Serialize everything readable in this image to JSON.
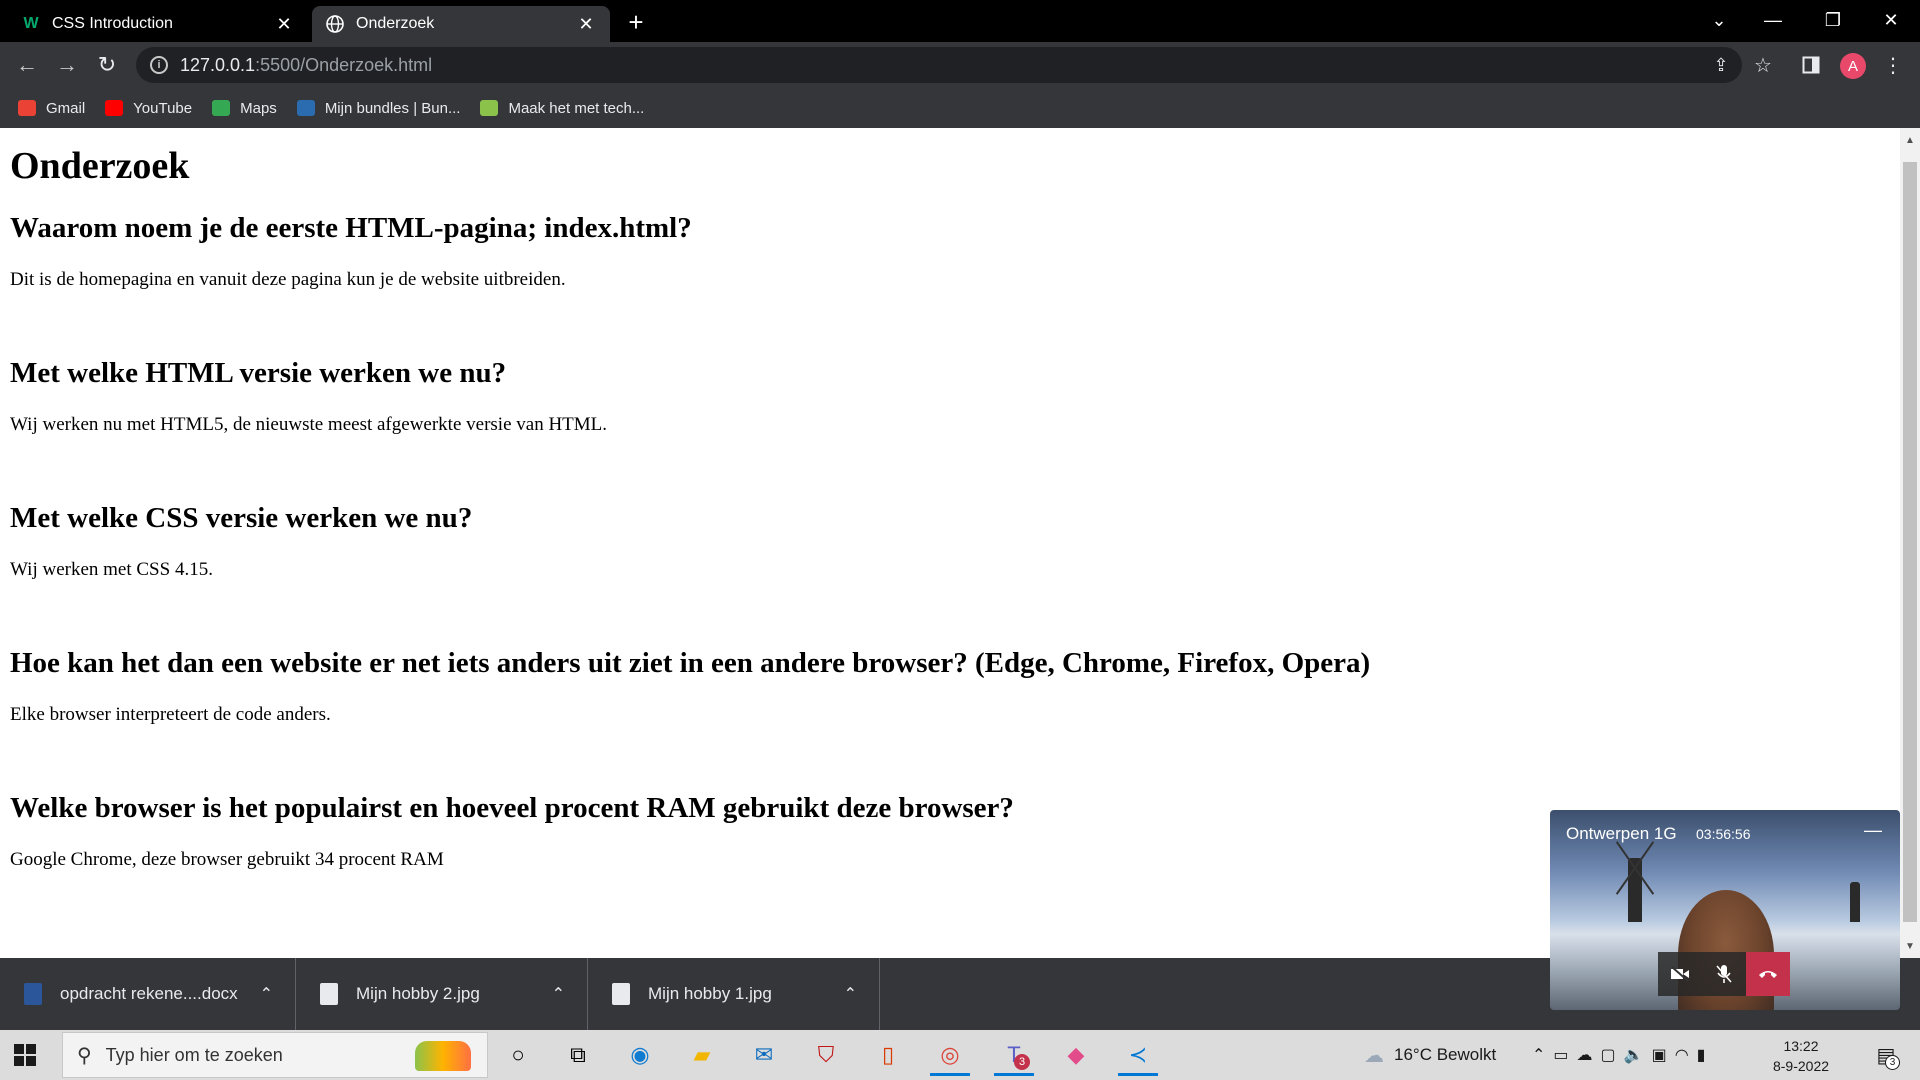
{
  "browser": {
    "tabs": [
      {
        "label": "CSS Introduction",
        "favicon": "w3schools-icon",
        "active": false
      },
      {
        "label": "Onderzoek",
        "favicon": "globe-icon",
        "active": true
      }
    ],
    "url_host": "127.0.0.1",
    "url_path": ":5500/Onderzoek.html",
    "profile_initial": "A",
    "bookmarks": [
      {
        "label": "Gmail",
        "icon": "gmail-icon",
        "color": "#ea4335"
      },
      {
        "label": "YouTube",
        "icon": "youtube-icon",
        "color": "#ff0000"
      },
      {
        "label": "Maps",
        "icon": "maps-icon",
        "color": "#34a853"
      },
      {
        "label": "Mijn bundles | Bun...",
        "icon": "bundles-icon",
        "color": "#2b6cb0"
      },
      {
        "label": "Maak het met tech...",
        "icon": "tech-icon",
        "color": "#8bc34a"
      }
    ]
  },
  "page": {
    "title": "Onderzoek",
    "sections": [
      {
        "heading": "Waarom noem je de eerste HTML-pagina; index.html?",
        "text": "Dit is de homepagina en vanuit deze pagina kun je de website uitbreiden."
      },
      {
        "heading": "Met welke HTML versie werken we nu?",
        "text": "Wij werken nu met HTML5, de nieuwste meest afgewerkte versie van HTML."
      },
      {
        "heading": "Met welke CSS versie werken we nu?",
        "text": "Wij werken met CSS 4.15."
      },
      {
        "heading": "Hoe kan het dan een website er net iets anders uit ziet in een andere browser? (Edge, Chrome, Firefox, Opera)",
        "text": "Elke browser interpreteert de code anders."
      },
      {
        "heading": "Welke browser is het populairst en hoeveel procent RAM gebruikt deze browser?",
        "text": "Google Chrome, deze browser gebruikt 34 procent RAM"
      }
    ]
  },
  "downloads": [
    {
      "label": "opdracht rekene....docx",
      "icon": "word-file-icon"
    },
    {
      "label": "Mijn hobby 2.jpg",
      "icon": "image-file-icon"
    },
    {
      "label": "Mijn hobby 1.jpg",
      "icon": "image-file-icon"
    }
  ],
  "teams_call": {
    "title": "Ontwerpen 1G",
    "timer": "03:56:56"
  },
  "taskbar": {
    "search_placeholder": "Typ hier om te zoeken",
    "weather": "16°C  Bewolkt",
    "time": "13:22",
    "date": "8-9-2022",
    "teams_badge": "3",
    "notification_count": "3"
  }
}
